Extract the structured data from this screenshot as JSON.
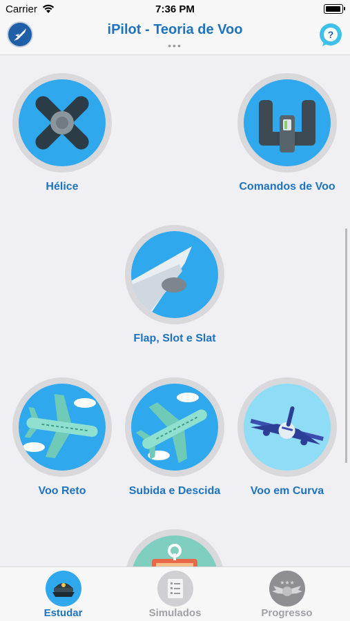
{
  "status_bar": {
    "carrier": "Carrier",
    "time": "7:36 PM"
  },
  "nav": {
    "title": "iPilot - Teoria de Voo",
    "more": "•••",
    "help_symbol": "?"
  },
  "topics": [
    {
      "id": "helice",
      "label": "Hélice",
      "icon": "propeller-icon"
    },
    {
      "id": "comandos",
      "label": "Comandos de Voo",
      "icon": "flight-controls-icon"
    },
    {
      "id": "flap",
      "label": "Flap, Slot e Slat",
      "icon": "wing-flap-icon"
    },
    {
      "id": "voo-reto",
      "label": "Voo Reto",
      "icon": "airplane-level-icon"
    },
    {
      "id": "subida",
      "label": "Subida e Descida",
      "icon": "airplane-climb-icon"
    },
    {
      "id": "curva",
      "label": "Voo em Curva",
      "icon": "airplane-turn-icon"
    },
    {
      "id": "partial",
      "label": "",
      "icon": "tag-icon"
    }
  ],
  "tabs": [
    {
      "label": "Estudar",
      "active": true,
      "icon": "pilot-cap-icon"
    },
    {
      "label": "Simulados",
      "active": false,
      "icon": "document-list-icon"
    },
    {
      "label": "Progresso",
      "active": false,
      "icon": "wings-badge-icon"
    }
  ],
  "colors": {
    "accent": "#1e73be",
    "disc_blue": "#2fa8ee",
    "disc_light": "#7fd3f5",
    "inactive": "#a0a0a5"
  }
}
